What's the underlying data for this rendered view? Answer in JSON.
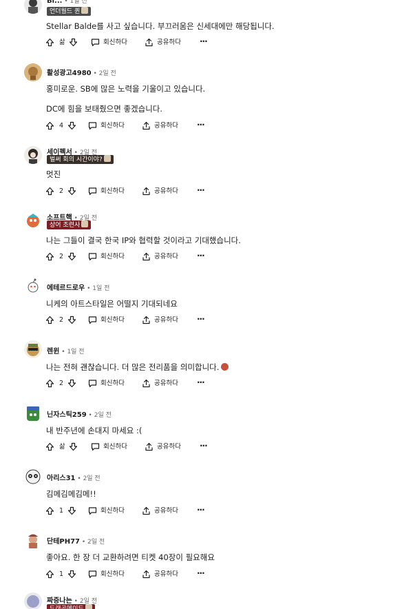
{
  "actions": {
    "upvote_icon": "arrow-up-icon",
    "downvote_icon": "arrow-down-icon",
    "reply_label": "회신하다",
    "share_label": "공유하다",
    "more_label": "···"
  },
  "comments": [
    {
      "username": "Bi...",
      "time": "1일 전",
      "flair": "언더월드 퀸",
      "flair_color": "#4b4b4b",
      "lines": [
        "Stellar Balde를 사고 싶습니다. 부끄러움은 신세대에만 해당됩니다."
      ],
      "score": "삶"
    },
    {
      "username": "활성광고4980",
      "time": "2일 전",
      "flair": "",
      "lines": [
        "홍미로운. SB에 많은 노력을 기울이고 있습니다.",
        "DC에 힘을 보태줬으면 좋겠습니다."
      ],
      "score": "4"
    },
    {
      "username": "세이펙서",
      "time": "2일 전",
      "flair": "벌써 회의 시간이야?",
      "flair_color": "#3a2e28",
      "lines": [
        "멋진"
      ],
      "score": "2"
    },
    {
      "username": "소프트핵",
      "time": "2일 전",
      "flair": "상어 조련사",
      "flair_color": "#7b1f24",
      "lines": [
        "나는 그들이 결국 한국 IP와 협력할 것이라고 기대했습니다."
      ],
      "score": "2"
    },
    {
      "username": "에테르드로우",
      "time": "1일 전",
      "flair": "",
      "lines": [
        "니케의 아트스타일은 어떨지 기대되네요"
      ],
      "score": "2"
    },
    {
      "username": "렌윈",
      "time": "1일 전",
      "flair": "",
      "lines": [
        "나는 전혀 괜찮습니다. 더 많은 전리품을 의미합니다."
      ],
      "score": "2"
    },
    {
      "username": "닌자스틱259",
      "time": "2일 전",
      "flair": "",
      "lines": [
        "내 반주년에 손대지 마세요 :("
      ],
      "score": "삶"
    },
    {
      "username": "아리스31",
      "time": "2일 전",
      "flair": "",
      "lines": [
        "김메김메김메!!"
      ],
      "score": "1"
    },
    {
      "username": "단테PH77",
      "time": "2일 전",
      "flair": "",
      "lines": [
        "좋아요. 한 장 더 교환하려면 티켓 40장이 필요해요"
      ],
      "score": "1"
    },
    {
      "username": "짜증나는",
      "time": "2일 전",
      "flair": "드래곤메이드",
      "flair_color": "#7b1f24",
      "lines": [],
      "score": ""
    }
  ]
}
